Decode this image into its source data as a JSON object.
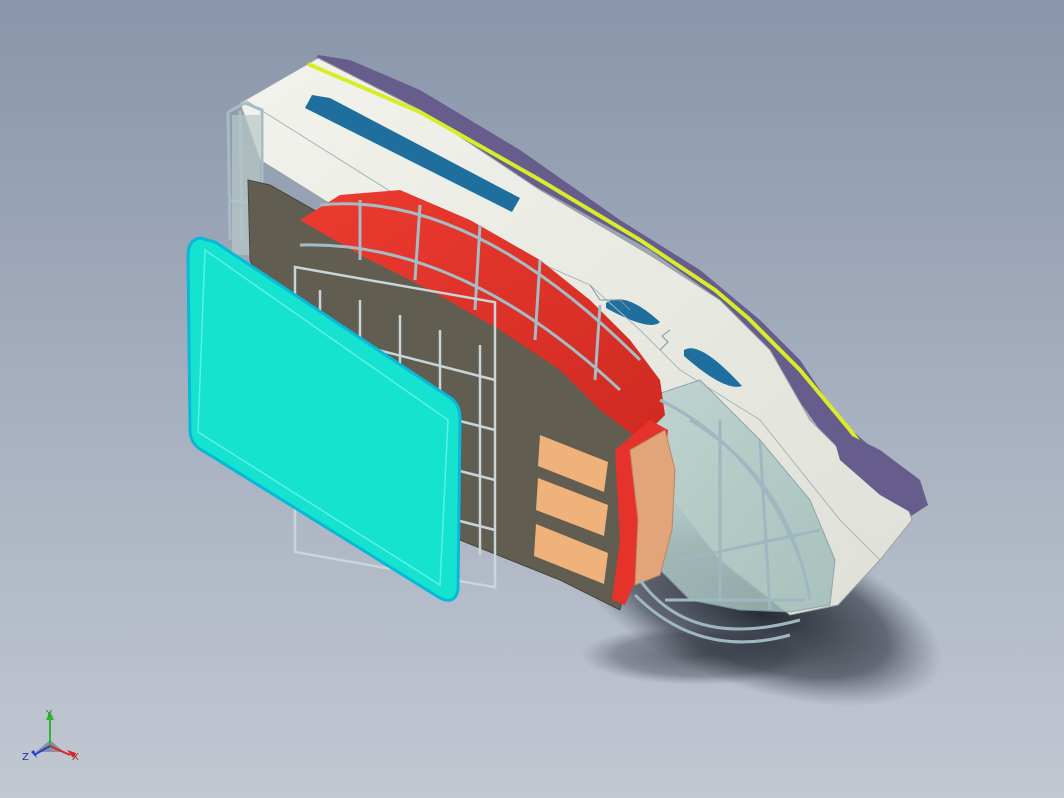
{
  "viewport": {
    "background_top": "#8995aa",
    "background_bottom": "#c2c8d2"
  },
  "model": {
    "colors": {
      "body_white": "#eef0e8",
      "roof_purple": "#665d8c",
      "stripe_yellow": "#d8ec2a",
      "window_blue": "#1f6f9e",
      "frame_steel": "#9fb7c0",
      "floor_dark": "#625d51",
      "door_cyan": "#16e3cf",
      "panel_red": "#e5332b",
      "seat_orange": "#f0b27b",
      "glass": "#a9c4c0"
    }
  },
  "triad": {
    "x_label": "X",
    "y_label": "Y",
    "z_label": "Z",
    "x_color": "#d8262b",
    "y_color": "#2fb52e",
    "z_color": "#2b3fd0"
  }
}
